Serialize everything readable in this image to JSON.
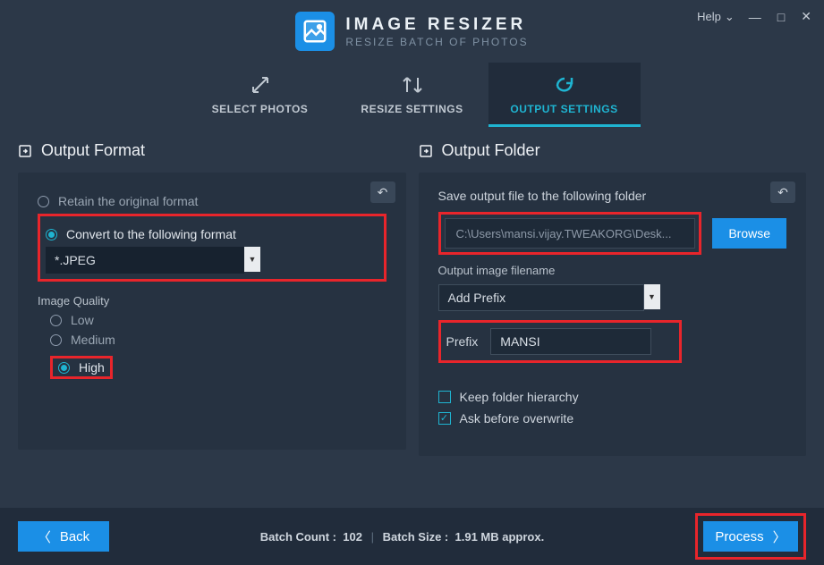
{
  "header": {
    "title": "IMAGE RESIZER",
    "subtitle": "RESIZE BATCH OF PHOTOS",
    "help": "Help"
  },
  "tabs": {
    "select": "SELECT PHOTOS",
    "resize": "RESIZE SETTINGS",
    "output": "OUTPUT SETTINGS"
  },
  "left": {
    "title": "Output Format",
    "retain": "Retain the original format",
    "convert": "Convert to the following format",
    "format_value": "*.JPEG",
    "quality_label": "Image Quality",
    "low": "Low",
    "medium": "Medium",
    "high": "High"
  },
  "right": {
    "title": "Output Folder",
    "save_label": "Save output file to the following folder",
    "path": "C:\\Users\\mansi.vijay.TWEAKORG\\Desk...",
    "browse": "Browse",
    "filename_label": "Output image filename",
    "mode_value": "Add Prefix",
    "prefix_label": "Prefix",
    "prefix_value": "MANSI",
    "keep_hierarchy": "Keep folder hierarchy",
    "ask_overwrite": "Ask before overwrite"
  },
  "footer": {
    "back": "Back",
    "count_label": "Batch Count :",
    "count_value": "102",
    "size_label": "Batch Size :",
    "size_value": "1.91 MB approx.",
    "process": "Process"
  }
}
